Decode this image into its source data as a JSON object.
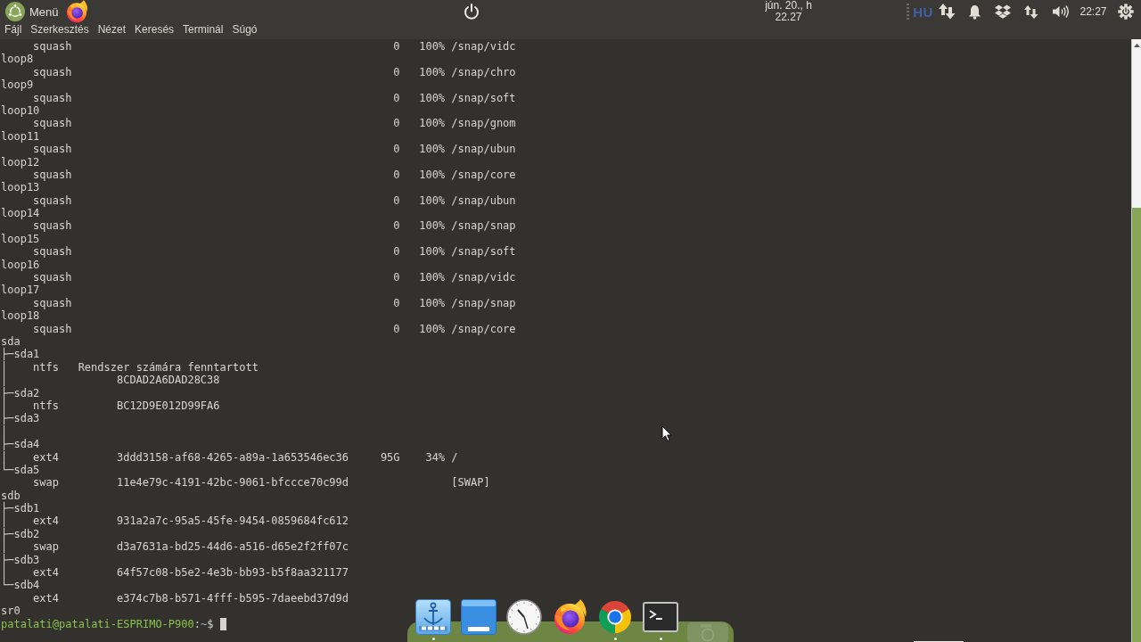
{
  "top_panel": {
    "menu_label": "Menü",
    "clock": {
      "date": "jún. 20., h",
      "time": "22.27"
    },
    "keyboard_layout": "HU",
    "time": "22:27"
  },
  "menubar": [
    "Fájl",
    "Szerkesztés",
    "Nézet",
    "Keresés",
    "Terminál",
    "Súgó"
  ],
  "terminal": {
    "rows": [
      {
        "kind": "fs",
        "fstype": "squash",
        "fsavail": "0",
        "fsuse": "100%",
        "mountpoint": "/snap/vidc"
      },
      {
        "kind": "device",
        "name": "loop8"
      },
      {
        "kind": "fs",
        "fstype": "squash",
        "fsavail": "0",
        "fsuse": "100%",
        "mountpoint": "/snap/chro"
      },
      {
        "kind": "device",
        "name": "loop9"
      },
      {
        "kind": "fs",
        "fstype": "squash",
        "fsavail": "0",
        "fsuse": "100%",
        "mountpoint": "/snap/soft"
      },
      {
        "kind": "device",
        "name": "loop10"
      },
      {
        "kind": "fs",
        "fstype": "squash",
        "fsavail": "0",
        "fsuse": "100%",
        "mountpoint": "/snap/gnom"
      },
      {
        "kind": "device",
        "name": "loop11"
      },
      {
        "kind": "fs",
        "fstype": "squash",
        "fsavail": "0",
        "fsuse": "100%",
        "mountpoint": "/snap/ubun"
      },
      {
        "kind": "device",
        "name": "loop12"
      },
      {
        "kind": "fs",
        "fstype": "squash",
        "fsavail": "0",
        "fsuse": "100%",
        "mountpoint": "/snap/core"
      },
      {
        "kind": "device",
        "name": "loop13"
      },
      {
        "kind": "fs",
        "fstype": "squash",
        "fsavail": "0",
        "fsuse": "100%",
        "mountpoint": "/snap/ubun"
      },
      {
        "kind": "device",
        "name": "loop14"
      },
      {
        "kind": "fs",
        "fstype": "squash",
        "fsavail": "0",
        "fsuse": "100%",
        "mountpoint": "/snap/snap"
      },
      {
        "kind": "device",
        "name": "loop15"
      },
      {
        "kind": "fs",
        "fstype": "squash",
        "fsavail": "0",
        "fsuse": "100%",
        "mountpoint": "/snap/soft"
      },
      {
        "kind": "device",
        "name": "loop16"
      },
      {
        "kind": "fs",
        "fstype": "squash",
        "fsavail": "0",
        "fsuse": "100%",
        "mountpoint": "/snap/vidc"
      },
      {
        "kind": "device",
        "name": "loop17"
      },
      {
        "kind": "fs",
        "fstype": "squash",
        "fsavail": "0",
        "fsuse": "100%",
        "mountpoint": "/snap/snap"
      },
      {
        "kind": "device",
        "name": "loop18"
      },
      {
        "kind": "fs",
        "fstype": "squash",
        "fsavail": "0",
        "fsuse": "100%",
        "mountpoint": "/snap/core"
      },
      {
        "kind": "device",
        "name": "sda"
      },
      {
        "kind": "device",
        "tree": "├─",
        "name": "sda1"
      },
      {
        "kind": "fs",
        "tree": "│",
        "fstype": "ntfs",
        "label": "Rendszer számára fenntartott"
      },
      {
        "kind": "fs",
        "tree": "│",
        "uuid": "8CDAD2A6DAD28C38"
      },
      {
        "kind": "device",
        "tree": "├─",
        "name": "sda2"
      },
      {
        "kind": "fs",
        "tree": "│",
        "fstype": "ntfs",
        "uuid": "BC12D9E012D99FA6"
      },
      {
        "kind": "device",
        "tree": "├─",
        "name": "sda3"
      },
      {
        "kind": "fs",
        "tree": "│"
      },
      {
        "kind": "device",
        "tree": "├─",
        "name": "sda4"
      },
      {
        "kind": "fs",
        "tree": "│",
        "fstype": "ext4",
        "uuid": "3ddd3158-af68-4265-a89a-1a653546ec36",
        "fsavail": "95G",
        "fsuse": "34%",
        "mountpoint": "/"
      },
      {
        "kind": "device",
        "tree": "└─",
        "name": "sda5"
      },
      {
        "kind": "fs",
        "fstype": "swap",
        "uuid": "11e4e79c-4191-42bc-9061-bfccce70c99d",
        "mountpoint": "[SWAP]"
      },
      {
        "kind": "device",
        "name": "sdb"
      },
      {
        "kind": "device",
        "tree": "├─",
        "name": "sdb1"
      },
      {
        "kind": "fs",
        "tree": "│",
        "fstype": "ext4",
        "uuid": "931a2a7c-95a5-45fe-9454-0859684fc612"
      },
      {
        "kind": "device",
        "tree": "├─",
        "name": "sdb2"
      },
      {
        "kind": "fs",
        "tree": "│",
        "fstype": "swap",
        "uuid": "d3a7631a-bd25-44d6-a516-d65e2f2ff07c"
      },
      {
        "kind": "device",
        "tree": "├─",
        "name": "sdb3"
      },
      {
        "kind": "fs",
        "tree": "│",
        "fstype": "ext4",
        "uuid": "64f57c08-b5e2-4e3b-bb93-b5f8aa321177"
      },
      {
        "kind": "device",
        "tree": "└─",
        "name": "sdb4"
      },
      {
        "kind": "fs",
        "fstype": "ext4",
        "uuid": "e374c7b8-b571-4fff-b595-7daeebd37d9d"
      },
      {
        "kind": "device",
        "name": "sr0"
      }
    ],
    "prompt": {
      "user_host": "patalati@patalati-ESPRIMO-P900",
      "separator": ":",
      "path": "~",
      "symbol": "$"
    }
  },
  "dock": {
    "items": [
      {
        "kind": "anchor",
        "running": true
      },
      {
        "kind": "window",
        "running": false
      },
      {
        "kind": "clock",
        "running": false
      },
      {
        "kind": "fox",
        "running": false
      },
      {
        "kind": "wheel",
        "running": true
      },
      {
        "kind": "terminal",
        "running": true
      }
    ]
  }
}
